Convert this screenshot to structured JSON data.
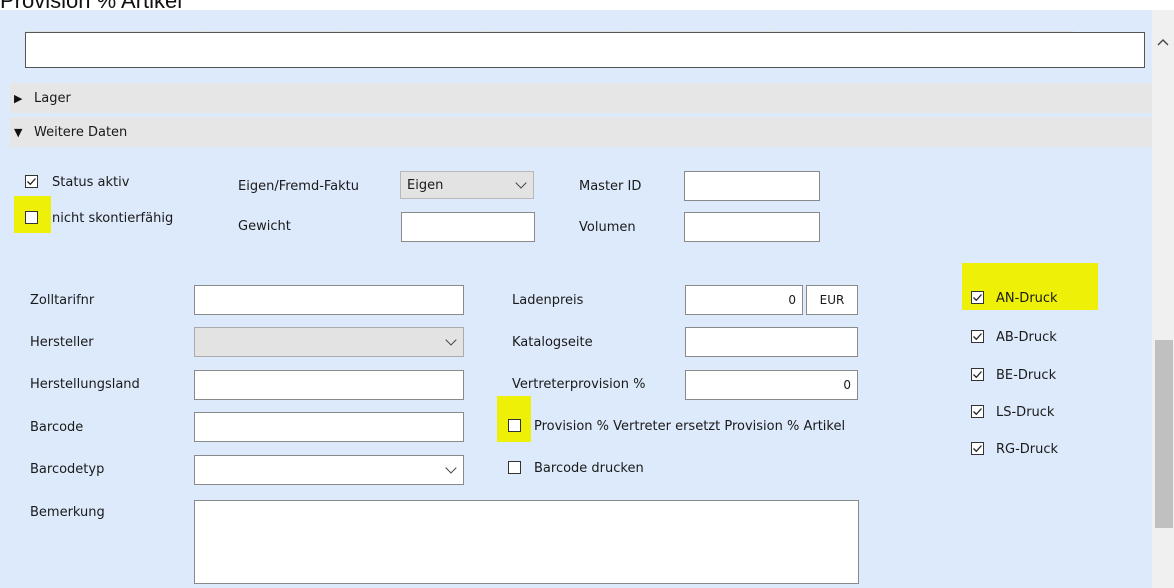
{
  "caption": "Provision % Artikel",
  "sections": {
    "lager": "Lager",
    "weitere_daten": "Weitere Daten"
  },
  "top": {
    "status_aktiv": {
      "label": "Status aktiv",
      "checked": true
    },
    "nicht_skontierfaehig": {
      "label": "nicht skontierfähig",
      "checked": false
    },
    "eigen_fremd_label": "Eigen/Fremd-Faktu",
    "eigen_fremd_value": "Eigen",
    "gewicht_label": "Gewicht",
    "gewicht_value": "",
    "master_id_label": "Master ID",
    "master_id_value": "",
    "volumen_label": "Volumen",
    "volumen_value": ""
  },
  "left": {
    "zolltarifnr_label": "Zolltarifnr",
    "zolltarifnr_value": "",
    "hersteller_label": "Hersteller",
    "hersteller_value": "",
    "herstellungsland_label": "Herstellungsland",
    "herstellungsland_value": "",
    "barcode_label": "Barcode",
    "barcode_value": "",
    "barcodetyp_label": "Barcodetyp",
    "barcodetyp_value": "",
    "bemerkung_label": "Bemerkung",
    "bemerkung_value": ""
  },
  "middle": {
    "ladenpreis_label": "Ladenpreis",
    "ladenpreis_value": "0",
    "currency": "EUR",
    "katalogseite_label": "Katalogseite",
    "katalogseite_value": "",
    "vertreterprovision_label": "Vertreterprovision %",
    "vertreterprovision_value": "0",
    "provision_ersetzt": {
      "label": "Provision % Vertreter ersetzt Provision % Artikel",
      "checked": false
    },
    "barcode_drucken": {
      "label": "Barcode drucken",
      "checked": false
    }
  },
  "druck": [
    {
      "label": "AN-Druck",
      "checked": true
    },
    {
      "label": "AB-Druck",
      "checked": true
    },
    {
      "label": "BE-Druck",
      "checked": true
    },
    {
      "label": "LS-Druck",
      "checked": true
    },
    {
      "label": "RG-Druck",
      "checked": true
    }
  ],
  "colors": {
    "panel": "#ddeafc",
    "section": "#e6e6e6",
    "highlight": "#eef007"
  }
}
